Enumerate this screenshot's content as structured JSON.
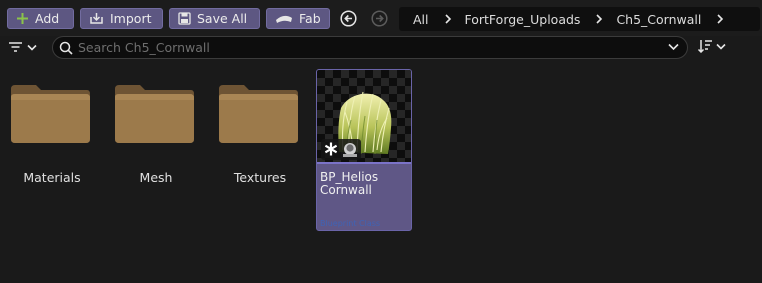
{
  "toolbar": {
    "add_label": "Add",
    "import_label": "Import",
    "save_all_label": "Save All",
    "fab_label": "Fab"
  },
  "breadcrumb": [
    "All",
    "FortForge_Uploads",
    "Ch5_Cornwall"
  ],
  "search": {
    "placeholder": "Search Ch5_Cornwall",
    "value": ""
  },
  "folders": [
    {
      "label": "Materials"
    },
    {
      "label": "Mesh"
    },
    {
      "label": "Textures"
    }
  ],
  "asset": {
    "name_line1": "BP_Helios",
    "name_line2": "Cornwall",
    "type_label": "Blueprint Class"
  },
  "colors": {
    "accent": "#5d5782",
    "asset_card": "#5f5786",
    "folder": "#9c7a4b",
    "add_icon": "#8bc34a",
    "asset_type_text": "#3f63b5"
  },
  "icons": [
    "plus-icon",
    "import-icon",
    "save-icon",
    "fab-icon",
    "back-icon",
    "forward-icon",
    "chevron-right-icon",
    "filter-icon",
    "search-icon",
    "chevron-down-icon",
    "sort-icon",
    "folder-icon",
    "blueprint-icon"
  ]
}
